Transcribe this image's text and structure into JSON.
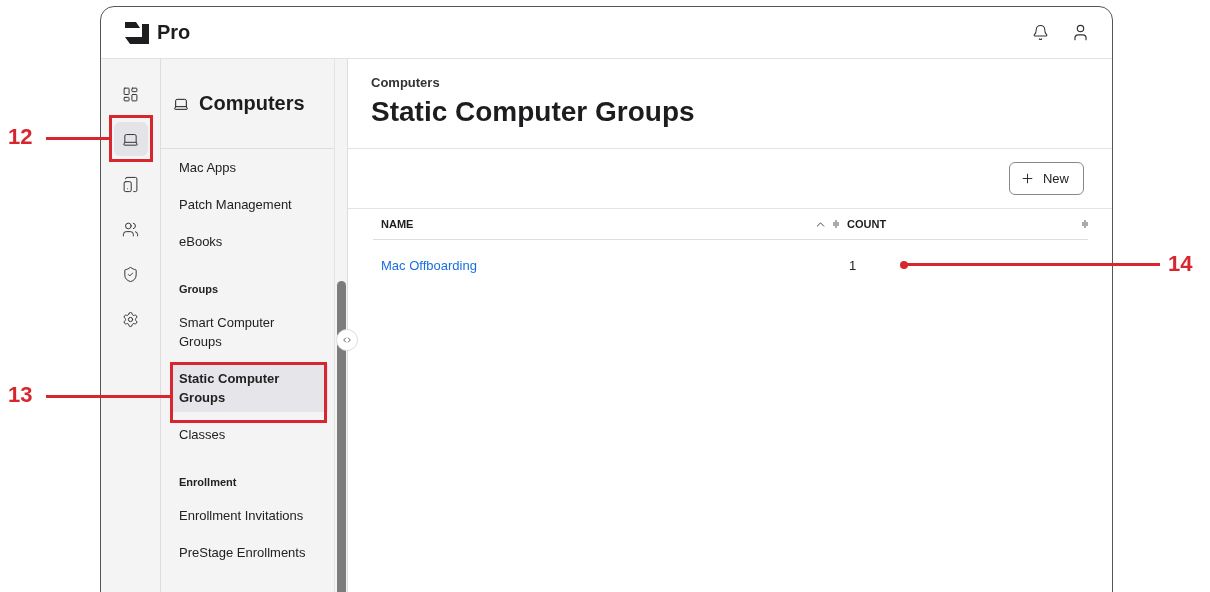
{
  "header": {
    "brand": "Pro"
  },
  "rail": {
    "items": [
      {
        "selected": false
      },
      {
        "selected": true
      },
      {
        "selected": false
      },
      {
        "selected": false
      },
      {
        "selected": false
      },
      {
        "selected": false
      }
    ]
  },
  "nav": {
    "title": "Computers",
    "items": [
      {
        "kind": "link",
        "label": "Mac Apps",
        "selected": false
      },
      {
        "kind": "link",
        "label": "Patch Management",
        "selected": false
      },
      {
        "kind": "link",
        "label": "eBooks",
        "selected": false
      },
      {
        "kind": "heading",
        "label": "Groups"
      },
      {
        "kind": "link",
        "label": "Smart Computer Groups",
        "selected": false
      },
      {
        "kind": "link",
        "label": "Static Computer Groups",
        "selected": true
      },
      {
        "kind": "link",
        "label": "Classes",
        "selected": false
      },
      {
        "kind": "heading",
        "label": "Enrollment"
      },
      {
        "kind": "link",
        "label": "Enrollment Invitations",
        "selected": false
      },
      {
        "kind": "link",
        "label": "PreStage Enrollments",
        "selected": false
      }
    ]
  },
  "main": {
    "breadcrumb": "Computers",
    "title": "Static Computer Groups",
    "new_button": "New",
    "table": {
      "columns": [
        {
          "label": "NAME",
          "sorted": true
        },
        {
          "label": "COUNT",
          "sorted": false
        }
      ],
      "rows": [
        {
          "name": "Mac Offboarding",
          "count": "1"
        }
      ]
    }
  },
  "callouts": [
    {
      "label": "12"
    },
    {
      "label": "13"
    },
    {
      "label": "14"
    }
  ]
}
